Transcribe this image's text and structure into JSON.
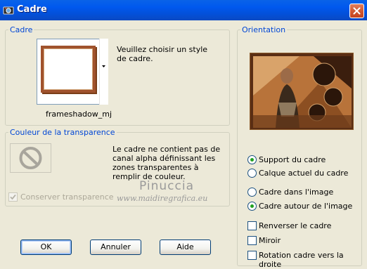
{
  "window": {
    "title": "Cadre"
  },
  "frame_group": {
    "label": "Cadre",
    "instructions": "Veuillez choisir un style de cadre.",
    "frame_name": "frameshadow_mj"
  },
  "transparency_group": {
    "label": "Couleur de la transparence",
    "message": "Le cadre ne contient pas de canal alpha définissant les zones transparentes à remplir de couleur.",
    "keep_transparency_label": "Conserver transparence",
    "keep_transparency_checked": true,
    "keep_transparency_enabled": false
  },
  "orientation_group": {
    "label": "Orientation"
  },
  "options": {
    "support_du_cadre": {
      "label": "Support du cadre",
      "selected": true
    },
    "calque_actuel": {
      "label": "Calque actuel du cadre",
      "selected": false
    },
    "cadre_dans_image": {
      "label": "Cadre dans l'image",
      "selected": false
    },
    "cadre_autour_image": {
      "label": "Cadre autour de l'image",
      "selected": true
    },
    "renverser": {
      "label": "Renverser le cadre",
      "checked": false
    },
    "miroir": {
      "label": "Miroir",
      "checked": false
    },
    "rotation": {
      "label": "Rotation cadre vers la droite",
      "checked": false
    }
  },
  "buttons": {
    "ok": "OK",
    "cancel": "Annuler",
    "help": "Aide"
  },
  "watermark": {
    "name": "Pinuccia",
    "url": "www.maidiregrafica.eu"
  },
  "colors": {
    "frame_brown": "#A0522D",
    "accent_blue": "#0046D5",
    "radio_green": "#21A121"
  }
}
